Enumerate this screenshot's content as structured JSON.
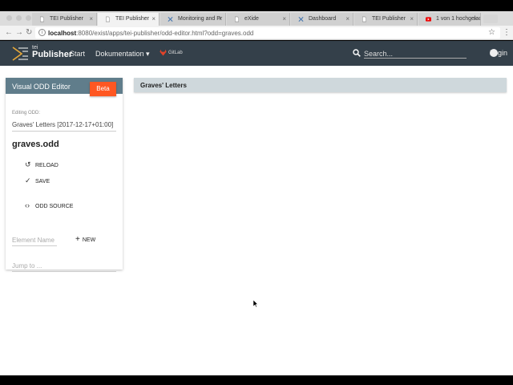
{
  "browser": {
    "tabs": [
      {
        "title": "TEI Publisher",
        "icon": "document-icon"
      },
      {
        "title": "TEI Publisher",
        "icon": "document-icon"
      },
      {
        "title": "Monitoring and Pr",
        "icon": "tools-icon"
      },
      {
        "title": "eXide",
        "icon": "document-icon"
      },
      {
        "title": "Dashboard",
        "icon": "tools-icon"
      },
      {
        "title": "TEI Publisher",
        "icon": "document-icon"
      },
      {
        "title": "1 von 1 hochgelad",
        "icon": "youtube-icon"
      }
    ],
    "url_host": "localhost",
    "url_path": ":8080/exist/apps/tei-publisher/odd-editor.html?odd=graves.odd"
  },
  "appbar": {
    "logo_small": "tei",
    "logo_big": "Publisher",
    "nav_start": "Start",
    "nav_doc": "Dokumentation ▾",
    "gitlab": "GitLab",
    "search_placeholder": "Search...",
    "login": "Login",
    "bg_color": "#34404a"
  },
  "odd_editor": {
    "title": "Visual ODD Editor",
    "badge": "Beta",
    "editing_label": "Editing ODD:",
    "editing_value": "Graves' Letters [2017-12-17+01:00]",
    "odd_name": "graves.odd",
    "reload": "RELOAD",
    "save": "SAVE",
    "odd_source": "ODD SOURCE",
    "element_placeholder": "Element Name",
    "new": "NEW",
    "jump_placeholder": "Jump to ..."
  },
  "main": {
    "title": "Graves' Letters"
  }
}
